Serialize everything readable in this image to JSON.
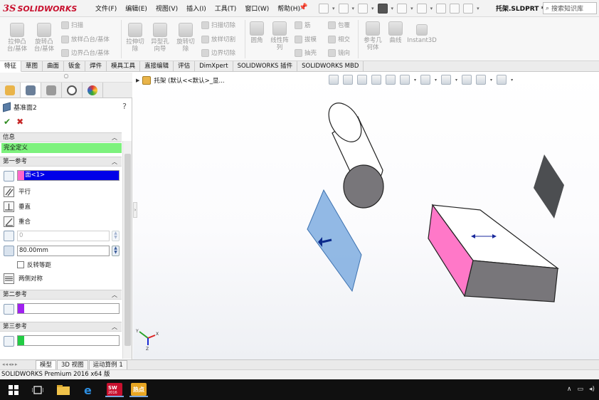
{
  "app": {
    "logo_prefix": "3S",
    "logo_text": "SOLIDWORKS",
    "filename": "托架.SLDPRT *",
    "search_placeholder": "搜索知识库"
  },
  "menus": [
    "文件(F)",
    "编辑(E)",
    "视图(V)",
    "插入(I)",
    "工具(T)",
    "窗口(W)",
    "帮助(H)"
  ],
  "ribbon": {
    "extrude_boss": [
      "拉伸凸",
      "台/基体"
    ],
    "revolve_boss": [
      "旋转凸",
      "台/基体"
    ],
    "sweep": "扫描",
    "loft_boss": "放样凸台/基体",
    "boundary_boss": "边界凸台/基体",
    "extrude_cut": [
      "拉伸切",
      "除"
    ],
    "hole_wizard": [
      "异型孔",
      "向导"
    ],
    "revolve_cut": [
      "旋转切",
      "除"
    ],
    "sweep_cut": "扫描切除",
    "loft_cut": "放样切割",
    "boundary_cut": "边界切除",
    "fillet": "圆角",
    "linear_pattern": [
      "线性阵",
      "列"
    ],
    "rib": "筋",
    "draft": "拔模",
    "shell": "抽壳",
    "wrap": "包覆",
    "intersect": "相交",
    "mirror": "镜向",
    "ref_geometry": [
      "参考几",
      "何体"
    ],
    "curves": "曲线",
    "instant3d": "Instant3D"
  },
  "cm_tabs": [
    "特征",
    "草图",
    "曲面",
    "钣金",
    "焊件",
    "模具工具",
    "直接编辑",
    "评估",
    "DimXpert",
    "SOLIDWORKS 插件",
    "SOLIDWORKS MBD"
  ],
  "property_manager": {
    "title": "基准面2",
    "help": "?",
    "ok": "✔",
    "cancel": "✖",
    "message_header": "信息",
    "status": "完全定义",
    "first_ref_header": "第一参考",
    "first_ref_value": "面<1>",
    "options": {
      "parallel": "平行",
      "perpendicular": "垂直",
      "coincident": "重合",
      "angle_value": "0",
      "distance_value": "80.00mm",
      "flip_offset": "反转等距",
      "mid_plane": "两侧对称"
    },
    "second_ref_header": "第二参考",
    "third_ref_header": "第三参考",
    "colors": {
      "first": "#ff66cc",
      "second": "#a020f0",
      "third": "#22cc44"
    }
  },
  "feature_tree": {
    "part_label": "托架 (默认<<默认>_显..."
  },
  "bottom_tabs": [
    "模型",
    "3D 视图",
    "运动算例 1"
  ],
  "status_bar": "SOLIDWORKS Premium 2016 x64 版",
  "triad": {
    "x": "X",
    "y": "Y",
    "z": "Z"
  },
  "taskbar": {
    "sw_badge": "2016",
    "app_label": "热点"
  }
}
